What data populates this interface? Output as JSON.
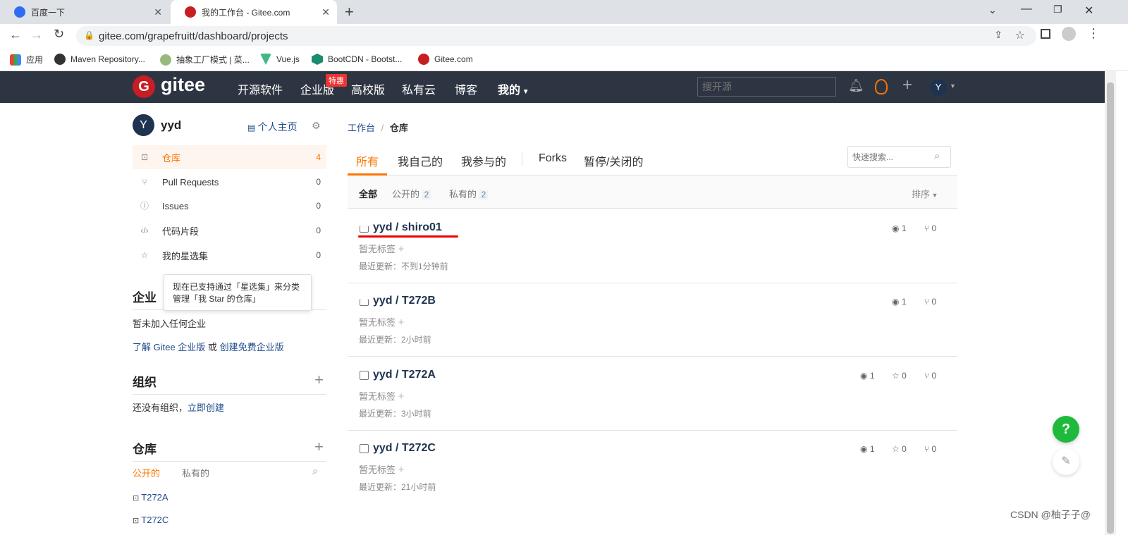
{
  "browser": {
    "tabs": [
      {
        "title": "百度一下",
        "active": false
      },
      {
        "title": "我的工作台 - Gitee.com",
        "active": true
      }
    ],
    "url": "gitee.com/grapefruitt/dashboard/projects",
    "bookmarks": [
      "应用",
      "Maven Repository...",
      "抽象工厂模式 | 菜...",
      "Vue.js",
      "BootCDN - Bootst...",
      "Gitee.com"
    ]
  },
  "nav": {
    "logo_text": "gitee",
    "items": [
      "开源软件",
      "企业版",
      "高校版",
      "私有云",
      "博客",
      "我的"
    ],
    "badge": "特惠",
    "search_placeholder": "搜开源",
    "avatar_letter": "Y",
    "brand_color": "#c71d23"
  },
  "sidebar": {
    "avatar_letter": "Y",
    "username": "yyd",
    "home_link": "个人主页",
    "menu": [
      {
        "label": "仓库",
        "count": "4",
        "active": true
      },
      {
        "label": "Pull Requests",
        "count": "0"
      },
      {
        "label": "Issues",
        "count": "0"
      },
      {
        "label": "代码片段",
        "count": "0"
      },
      {
        "label": "我的星选集",
        "count": "0"
      }
    ],
    "tooltip_line1": "现在已支持通过「星选集」来分类",
    "tooltip_line2": "管理「我 Star 的仓库」",
    "enterprise": {
      "heading": "企业",
      "empty": "暂未加入任何企业",
      "learn": "了解 Gitee 企业版",
      "or": "或",
      "create": "创建免费企业版"
    },
    "org": {
      "heading": "组织",
      "empty": "还没有组织，",
      "create": "立即创建"
    },
    "repos": {
      "heading": "仓库",
      "tab_public": "公开的",
      "tab_private": "私有的",
      "items": [
        "T272A",
        "T272C"
      ]
    }
  },
  "breadcrumb": {
    "root": "工作台",
    "sep": "/",
    "current": "仓库"
  },
  "tabs": {
    "items": [
      "所有",
      "我自己的",
      "我参与的",
      "Forks",
      "暂停/关闭的"
    ],
    "active_index": 0,
    "search_placeholder": "快速搜索..."
  },
  "filter": {
    "all": "全部",
    "public": "公开的",
    "public_count": "2",
    "private": "私有的",
    "private_count": "2",
    "sort": "排序"
  },
  "repos": [
    {
      "name": "yyd / shiro01",
      "private": true,
      "tag": "暂无标签",
      "updated": "最近更新：不到1分钟前",
      "watch": "1",
      "star": null,
      "fork": "0",
      "underlined": true
    },
    {
      "name": "yyd / T272B",
      "private": true,
      "tag": "暂无标签",
      "updated": "最近更新：2小时前",
      "watch": "1",
      "star": null,
      "fork": "0"
    },
    {
      "name": "yyd / T272A",
      "private": false,
      "tag": "暂无标签",
      "updated": "最近更新：3小时前",
      "watch": "1",
      "star": "0",
      "fork": "0"
    },
    {
      "name": "yyd / T272C",
      "private": false,
      "tag": "暂无标签",
      "updated": "最近更新：21小时前",
      "watch": "1",
      "star": "0",
      "fork": "0"
    }
  ],
  "help": "?",
  "watermark": "CSDN @柚子子@",
  "accent": "#fe7300"
}
